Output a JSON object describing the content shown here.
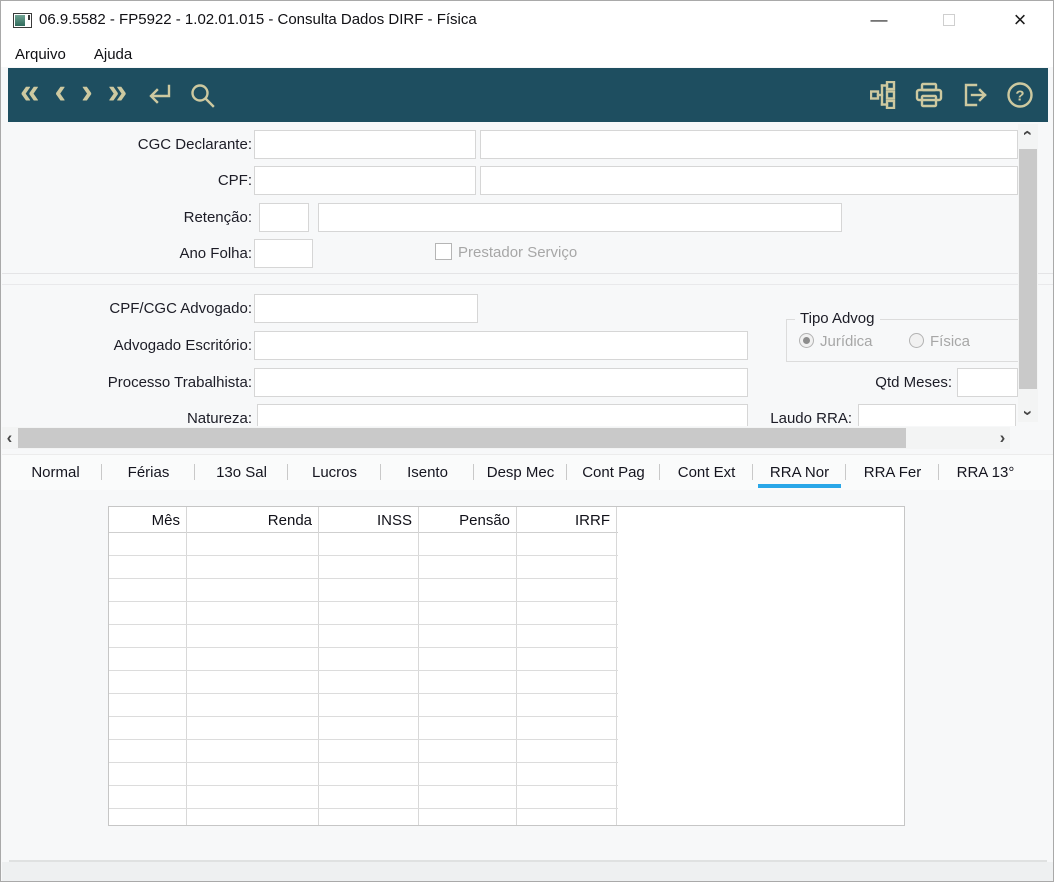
{
  "window": {
    "title": "06.9.5582 - FP5922 - 1.02.01.015 - Consulta Dados DIRF - Física",
    "controls": [
      "minimize",
      "maximize",
      "close"
    ]
  },
  "menu": {
    "items": [
      "Arquivo",
      "Ajuda"
    ]
  },
  "toolbar": {
    "nav_icons": [
      "first-record",
      "previous-record",
      "next-record",
      "last-record",
      "go-to",
      "search"
    ],
    "action_icons": [
      "related-programs",
      "print",
      "exit",
      "help"
    ]
  },
  "form": {
    "cgc_declarante": {
      "label": "CGC Declarante:",
      "code": "",
      "desc": ""
    },
    "cpf": {
      "label": "CPF:",
      "code": "",
      "desc": ""
    },
    "retencao": {
      "label": "Retenção:",
      "code": "",
      "desc": ""
    },
    "ano_folha": {
      "label": "Ano Folha:",
      "value": ""
    },
    "prestador_servico": {
      "label": "Prestador Serviço",
      "checked": false
    },
    "cpf_cgc_advogado": {
      "label": "CPF/CGC Advogado:",
      "value": ""
    },
    "advogado_escritorio": {
      "label": "Advogado Escritório:",
      "value": ""
    },
    "processo_trabalhista": {
      "label": "Processo Trabalhista:",
      "value": ""
    },
    "natureza": {
      "label": "Natureza:",
      "value": ""
    },
    "tipo_advog": {
      "legend": "Tipo Advog",
      "options": [
        {
          "label": "Jurídica",
          "selected": true,
          "enabled": false
        },
        {
          "label": "Física",
          "selected": false,
          "enabled": false
        }
      ]
    },
    "qtd_meses": {
      "label": "Qtd Meses:",
      "value": ""
    },
    "laudo_rra": {
      "label": "Laudo RRA:",
      "value": ""
    }
  },
  "tabs": {
    "items": [
      "Normal",
      "Férias",
      "13o Sal",
      "Lucros",
      "Isento",
      "Desp Mec",
      "Cont Pag",
      "Cont Ext",
      "RRA Nor",
      "RRA Fer",
      "RRA 13°"
    ],
    "selected": "RRA Nor",
    "selected_index": 8
  },
  "grid": {
    "columns": [
      "Mês",
      "Renda",
      "INSS",
      "Pensão",
      "IRRF"
    ],
    "rows": []
  },
  "colors": {
    "toolbar_bg": "#1e4e60",
    "toolbar_icon": "#cdc9a0",
    "tab_accent": "#2aa7e8",
    "form_bg": "#f7f8f9",
    "disabled_text": "#a7a7a7"
  }
}
